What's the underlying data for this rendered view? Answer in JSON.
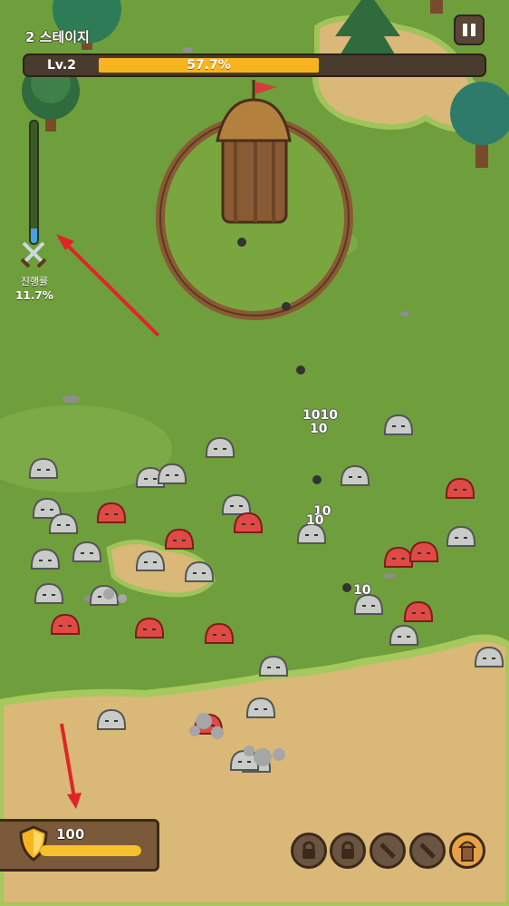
{
  "stage": {
    "label": "2 스테이지"
  },
  "level": {
    "label": "Lv.2",
    "percent_text": "57.7%",
    "fraction": 0.577
  },
  "progress": {
    "label": "진행률",
    "percent_text": "11.7%",
    "fraction": 0.117
  },
  "player": {
    "hp_text": "100",
    "hp_fraction": 1.0
  },
  "damage_texts": [
    "1010",
    "10",
    "10",
    "10",
    "10"
  ],
  "skills": [
    {
      "icon": "lock-icon",
      "state": "locked"
    },
    {
      "icon": "lock-icon",
      "state": "locked"
    },
    {
      "icon": "sword-icon",
      "state": "available"
    },
    {
      "icon": "sword-icon",
      "state": "available"
    },
    {
      "icon": "tower-icon",
      "state": "active"
    }
  ],
  "colors": {
    "grass": "#6f9e3c",
    "dirt": "#d9b878",
    "accent": "#f6b51f",
    "slime_red": "#e04a45",
    "slime_gray": "#c9cbc9"
  }
}
